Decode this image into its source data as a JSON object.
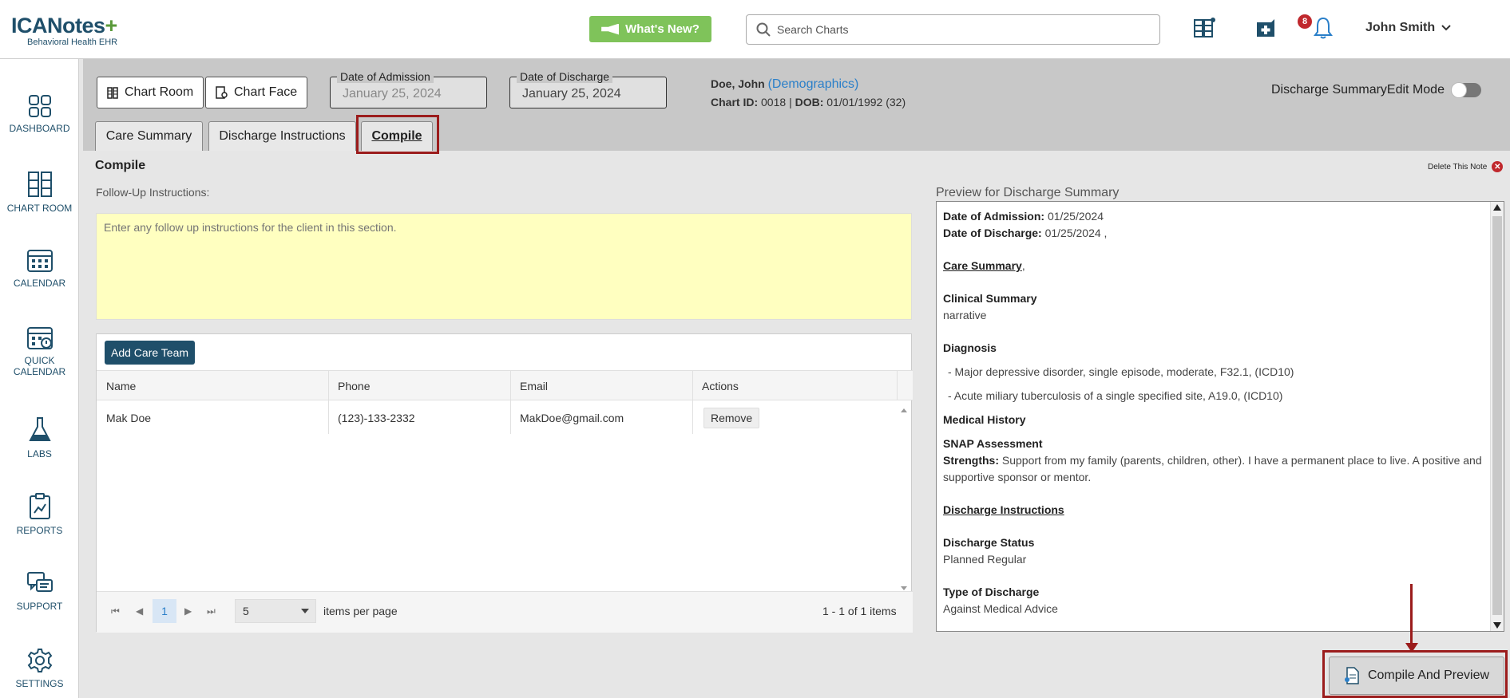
{
  "header": {
    "logo_main": "ICANotes",
    "logo_plus": "+",
    "logo_sub": "Behavioral Health EHR",
    "whats_new": "What's New?",
    "search_placeholder": "Search Charts",
    "notification_count": "8",
    "user_name": "John Smith"
  },
  "sidebar": {
    "items": [
      {
        "label": "DASHBOARD",
        "icon": "dashboard-icon"
      },
      {
        "label": "CHART ROOM",
        "icon": "chart-room-icon"
      },
      {
        "label": "CALENDAR",
        "icon": "calendar-icon"
      },
      {
        "label": "QUICK CALENDAR",
        "icon": "quick-calendar-icon"
      },
      {
        "label": "LABS",
        "icon": "flask-icon"
      },
      {
        "label": "REPORTS",
        "icon": "reports-icon"
      },
      {
        "label": "SUPPORT",
        "icon": "support-icon"
      },
      {
        "label": "SETTINGS",
        "icon": "gear-icon"
      }
    ]
  },
  "toolbar": {
    "chart_room": "Chart Room",
    "chart_face": "Chart Face",
    "admission_legend": "Date of Admission",
    "admission_value": "January 25, 2024",
    "discharge_legend": "Date of Discharge",
    "discharge_value": "January 25, 2024",
    "edit_mode_label": "Discharge SummaryEdit Mode"
  },
  "patient": {
    "name": "Doe, John",
    "demographics_link": "(Demographics)",
    "chart_id_label": "Chart ID:",
    "chart_id": "0018",
    "separator": "|",
    "dob_label": "DOB:",
    "dob": "01/01/1992 (32)"
  },
  "tabs": [
    {
      "label": "Care Summary"
    },
    {
      "label": "Discharge Instructions"
    },
    {
      "label": "Compile"
    }
  ],
  "compile": {
    "title": "Compile",
    "delete_note": "Delete This Note",
    "follow_up_label": "Follow-Up Instructions:",
    "follow_up_placeholder": "Enter any follow up instructions for the client in this section.",
    "add_care_team": "Add Care Team",
    "columns": [
      "Name",
      "Phone",
      "Email",
      "Actions"
    ],
    "rows": [
      {
        "name": "Mak Doe",
        "phone": "(123)-133-2332",
        "email": "MakDoe@gmail.com",
        "action": "Remove"
      }
    ],
    "pager": {
      "first": "⏮",
      "prev": "◀",
      "current_page": "1",
      "next": "▶",
      "last": "⏭",
      "page_size": "5",
      "per_page_label": "items per page",
      "summary": "1 - 1 of 1 items"
    },
    "compile_button": "Compile And Preview"
  },
  "preview": {
    "label": "Preview for Discharge Summary",
    "admission_label": "Date of Admission:",
    "admission_value": "01/25/2024",
    "discharge_label": "Date of Discharge:",
    "discharge_value": "01/25/2024 ,",
    "care_summary": "Care Summary",
    "care_summary_suffix": ",",
    "clinical_summary": "Clinical Summary",
    "clinical_text": "narrative",
    "diagnosis": "Diagnosis",
    "diagnosis_1": "- Major depressive disorder, single episode, moderate, F32.1, (ICD10)",
    "diagnosis_2": "- Acute miliary tuberculosis of a single specified site, A19.0, (ICD10)",
    "medical_history": "Medical History",
    "snap": "SNAP Assessment",
    "strengths_label": "Strengths:",
    "strengths_text": "Support from my family (parents, children, other). I have a permanent place to live. A positive and supportive sponsor or mentor.",
    "discharge_instructions": "Discharge Instructions",
    "discharge_status": "Discharge Status",
    "discharge_status_value": "Planned Regular",
    "type_of_discharge": "Type of Discharge",
    "type_of_discharge_value": "Against Medical Advice"
  },
  "colors": {
    "brand": "#1f4f6a",
    "accent_green": "#7fc35a",
    "highlight_red": "#9b1c1c",
    "link_blue": "#2a7fc9",
    "note_yellow": "#ffffc0"
  }
}
